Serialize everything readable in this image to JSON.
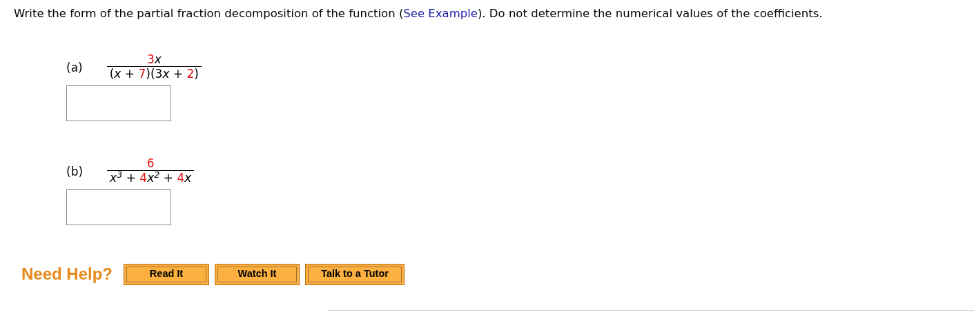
{
  "instructions": {
    "before": "Write the form of the partial fraction decomposition of the function (",
    "link": "See Example",
    "after": "). Do not determine the numerical values of the coefficients."
  },
  "parts": [
    {
      "label": "(a)",
      "numerator": [
        {
          "kind": "num",
          "text": "3"
        },
        {
          "kind": "var",
          "text": "x"
        }
      ],
      "denominator": [
        {
          "kind": "op",
          "text": "("
        },
        {
          "kind": "var",
          "text": "x"
        },
        {
          "kind": "op",
          "text": " + "
        },
        {
          "kind": "num",
          "text": "7"
        },
        {
          "kind": "op",
          "text": ")(3"
        },
        {
          "kind": "var",
          "text": "x"
        },
        {
          "kind": "op",
          "text": " + "
        },
        {
          "kind": "num",
          "text": "2"
        },
        {
          "kind": "op",
          "text": ")"
        }
      ]
    },
    {
      "label": "(b)",
      "numerator": [
        {
          "kind": "num",
          "text": "6"
        }
      ],
      "denominator": [
        {
          "kind": "var",
          "text": "x$^{3}$"
        },
        {
          "kind": "op",
          "text": " + "
        },
        {
          "kind": "num",
          "text": "4"
        },
        {
          "kind": "var",
          "text": "x$^{2}$"
        },
        {
          "kind": "op",
          "text": " + "
        },
        {
          "kind": "num",
          "text": "4"
        },
        {
          "kind": "var",
          "text": "x"
        }
      ]
    }
  ],
  "help": {
    "label": "Need Help?",
    "buttons": [
      "Read It",
      "Watch It",
      "Talk to a Tutor"
    ]
  }
}
